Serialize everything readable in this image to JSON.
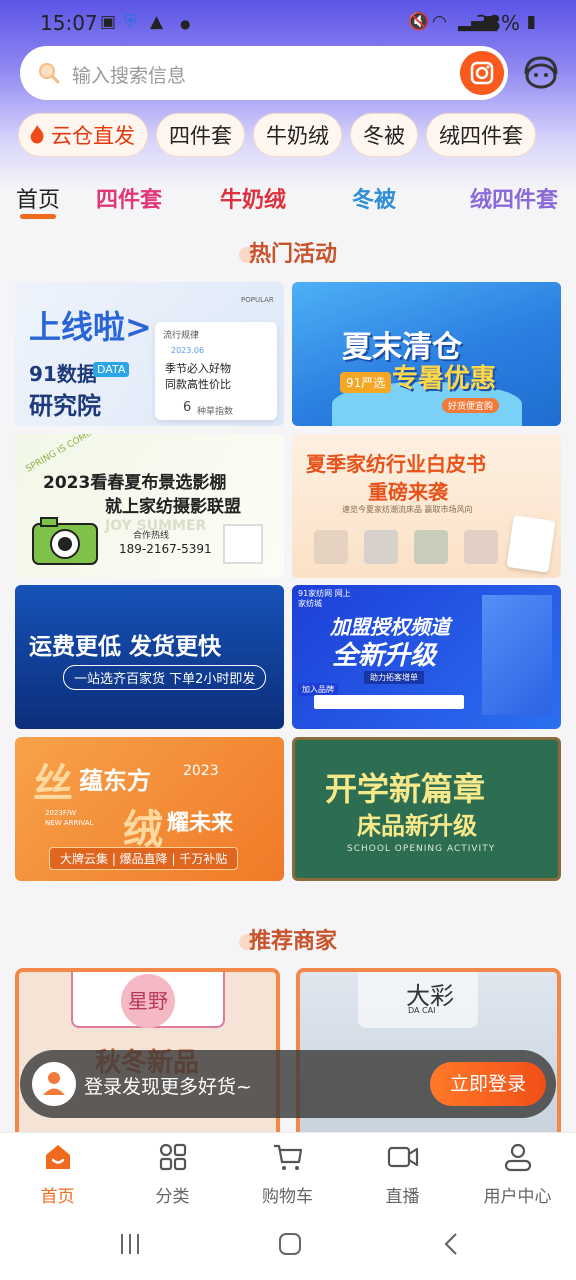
{
  "status": {
    "time": "15:07",
    "battery": "38%"
  },
  "search": {
    "placeholder": "输入搜索信息"
  },
  "chips": [
    "云仓直发",
    "四件套",
    "牛奶绒",
    "冬被",
    "绒四件套"
  ],
  "nav_tabs": [
    "首页",
    "四件套",
    "牛奶绒",
    "冬被",
    "绒四件套"
  ],
  "sections": {
    "hot": "热门活动",
    "recommend": "推荐商家"
  },
  "banners": {
    "b1": {
      "title": "上线啦>",
      "line1": "91数据",
      "tag": "DATA",
      "line2": "研究院",
      "card_head": "流行规律",
      "card_date": "2023.06",
      "card_l1": "季节必入好物",
      "card_l2": "同款高性价比",
      "card_idx": "6",
      "card_idx_label": "种草指数",
      "popular": "POPULAR"
    },
    "b2": {
      "line1": "夏末清仓",
      "line2": "专暑优惠",
      "tag": "91严选",
      "sub": "好货便宜购"
    },
    "b3": {
      "spring": "SPRING IS COMING",
      "line1": "2023看春夏布景选影棚",
      "line2": "就上家纺摄影联盟",
      "summer": "JOY SUMMER",
      "hotline_label": "合作热线",
      "phone": "189-2167-5391"
    },
    "b4": {
      "line1": "夏季家纺行业白皮书",
      "line2": "重磅来袭",
      "sub": "速览今夏家纺潮流床品 赢取市场风向"
    },
    "b5": {
      "line1": "运费更低 发货更快",
      "sub": "一站选齐百家货 下单2小时即发"
    },
    "b6": {
      "logo": "91家纺网 网上家纺城",
      "line1": "加盟授权频道",
      "line2": "全新升级",
      "sub": "助力拓客增单",
      "brands_label": "加入品牌"
    },
    "b7": {
      "c1": "丝",
      "c2": "蕴东方",
      "c3": "绒",
      "c4": "耀未来",
      "year": "2023",
      "new": "2023F/W",
      "arrival": "NEW ARRIVAL",
      "bar": "大牌云集 | 爆品直降 | 千万补贴"
    },
    "b8": {
      "line1": "开学新篇章",
      "line2": "床品新升级",
      "sub": "SCHOOL OPENING ACTIVITY"
    }
  },
  "merchants": {
    "m1_logo": "星野",
    "m1_title": "秋冬新品",
    "m2_logo": "大彩",
    "m2_sub": "DA CAI"
  },
  "login_bar": {
    "text": "登录发现更多好货~",
    "button": "立即登录"
  },
  "tabbar": [
    "首页",
    "分类",
    "购物车",
    "直播",
    "用户中心"
  ],
  "colors": {
    "accent": "#f06a1e",
    "header": "#5b54e6"
  }
}
